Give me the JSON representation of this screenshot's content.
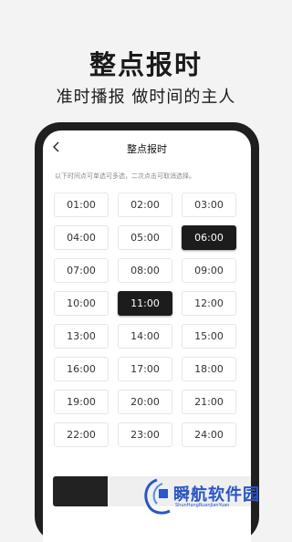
{
  "promo": {
    "title": "整点报时",
    "subtitle": "准时播报  做时间的主人"
  },
  "screen": {
    "nav_title": "整点报时",
    "back_icon": "chevron-left-icon",
    "hint": "以下时间点可单选可多选，二次点击可取消选择。"
  },
  "times": [
    {
      "label": "01:00",
      "selected": false
    },
    {
      "label": "02:00",
      "selected": false
    },
    {
      "label": "03:00",
      "selected": false
    },
    {
      "label": "04:00",
      "selected": false
    },
    {
      "label": "05:00",
      "selected": false
    },
    {
      "label": "06:00",
      "selected": true
    },
    {
      "label": "07:00",
      "selected": false
    },
    {
      "label": "08:00",
      "selected": false
    },
    {
      "label": "09:00",
      "selected": false
    },
    {
      "label": "10:00",
      "selected": false
    },
    {
      "label": "11:00",
      "selected": true
    },
    {
      "label": "12:00",
      "selected": false
    },
    {
      "label": "13:00",
      "selected": false
    },
    {
      "label": "14:00",
      "selected": false
    },
    {
      "label": "15:00",
      "selected": false
    },
    {
      "label": "16:00",
      "selected": false
    },
    {
      "label": "17:00",
      "selected": false
    },
    {
      "label": "18:00",
      "selected": false
    },
    {
      "label": "19:00",
      "selected": false
    },
    {
      "label": "20:00",
      "selected": false
    },
    {
      "label": "21:00",
      "selected": false
    },
    {
      "label": "22:00",
      "selected": false
    },
    {
      "label": "23:00",
      "selected": false
    },
    {
      "label": "24:00",
      "selected": false
    }
  ],
  "watermark": {
    "text": "瞬航软件园",
    "sub": "ShunHangRuanJianYuan",
    "color": "#2a56c6"
  },
  "colors": {
    "selected_bg": "#1c1c1c",
    "phone_frame": "#1f1f1f"
  }
}
